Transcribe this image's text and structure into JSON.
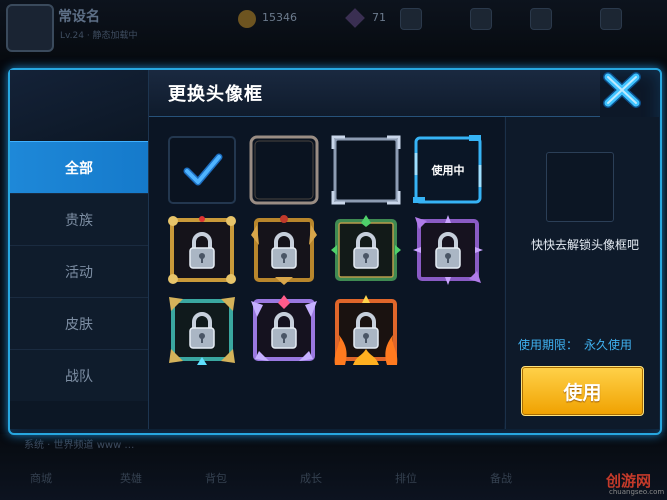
{
  "background": {
    "player_name": "常设名",
    "player_sub": "Lv.24 · 静态加载中",
    "coins": "15346",
    "gems": "71",
    "chat": "系统 · 世界频道 www …",
    "nav": [
      "商城",
      "英雄",
      "背包",
      "成长",
      "排位",
      "备战"
    ]
  },
  "modal": {
    "title": "更换头像框",
    "close_icon": "close-x-icon"
  },
  "sidebar": {
    "items": [
      {
        "label": "全部",
        "active": true
      },
      {
        "label": "贵族",
        "active": false
      },
      {
        "label": "活动",
        "active": false
      },
      {
        "label": "皮肤",
        "active": false
      },
      {
        "label": "战队",
        "active": false
      }
    ]
  },
  "frames": [
    {
      "state": "selected",
      "style": "plain-dark"
    },
    {
      "state": "unlocked",
      "style": "silver-rounded"
    },
    {
      "state": "unlocked",
      "style": "silver-bracket"
    },
    {
      "state": "in-use",
      "style": "blue-tech",
      "label": "使用中"
    },
    {
      "state": "locked",
      "style": "gold-ornate"
    },
    {
      "state": "locked",
      "style": "gold-winged"
    },
    {
      "state": "locked",
      "style": "green-emerald"
    },
    {
      "state": "locked",
      "style": "purple-spiked"
    },
    {
      "state": "locked",
      "style": "teal-gold"
    },
    {
      "state": "locked",
      "style": "violet-crystal"
    },
    {
      "state": "locked",
      "style": "fire-flame"
    }
  ],
  "right_panel": {
    "unlock_hint": "快快去解锁头像框吧",
    "period_label": "使用期限：",
    "period_value": "永久使用",
    "use_button": "使用"
  },
  "watermark": {
    "title": "创游网",
    "url": "chuangseo.com"
  },
  "colors": {
    "accent": "#27a7e0",
    "active_tab": "#1e88d8",
    "use_button": "#f5b400",
    "period_text": "#3fb1f0"
  }
}
